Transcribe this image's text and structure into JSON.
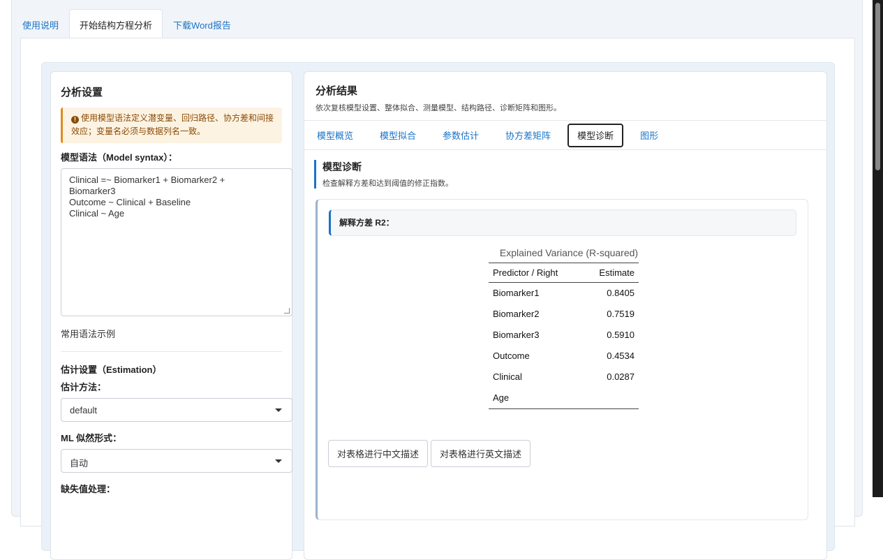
{
  "top_tabs": [
    {
      "label": "使用说明"
    },
    {
      "label": "开始结构方程分析"
    },
    {
      "label": "下载Word报告"
    }
  ],
  "settings": {
    "title": "分析设置",
    "hint": "使用模型语法定义潜变量、回归路径、协方差和间接效应；变量名必须与数据列名一致。",
    "syntax_label": "模型语法（Model syntax）：",
    "syntax_value": "Clinical =~ Biomarker1 + Biomarker2 +\nBiomarker3\nOutcome ~ Clinical + Baseline\nClinical ~ Age",
    "examples_link": "常用语法示例",
    "estimation_title": "估计设置（Estimation）",
    "method_label": "估计方法：",
    "method_value": "default",
    "ml_label": "ML 似然形式：",
    "ml_value": "自动",
    "missing_label": "缺失值处理："
  },
  "results": {
    "title": "分析结果",
    "subtitle": "依次复核模型设置、整体拟合、测量模型、结构路径、诊断矩阵和图形。",
    "tabs": [
      {
        "label": "模型概览"
      },
      {
        "label": "模型拟合"
      },
      {
        "label": "参数估计"
      },
      {
        "label": "协方差矩阵"
      },
      {
        "label": "模型诊断"
      },
      {
        "label": "图形"
      }
    ],
    "section_title": "模型诊断",
    "section_sub": "检查解释方差和达到阈值的修正指数。",
    "card_header": "解释方差 R2：",
    "table_caption": "Explained Variance (R-squared)",
    "table_headers": [
      "Predictor / Right",
      "Estimate"
    ],
    "table_rows": [
      {
        "name": "Biomarker1",
        "value": "0.8405"
      },
      {
        "name": "Biomarker2",
        "value": "0.7519"
      },
      {
        "name": "Biomarker3",
        "value": "0.5910"
      },
      {
        "name": "Outcome",
        "value": "0.4534"
      },
      {
        "name": "Clinical",
        "value": "0.0287"
      },
      {
        "name": "Age",
        "value": ""
      }
    ],
    "btn_cn": "对表格进行中文描述",
    "btn_en": "对表格进行英文描述"
  },
  "icons": {
    "hint_icon": "info-circle-icon",
    "select_caret": "caret-down-icon"
  }
}
